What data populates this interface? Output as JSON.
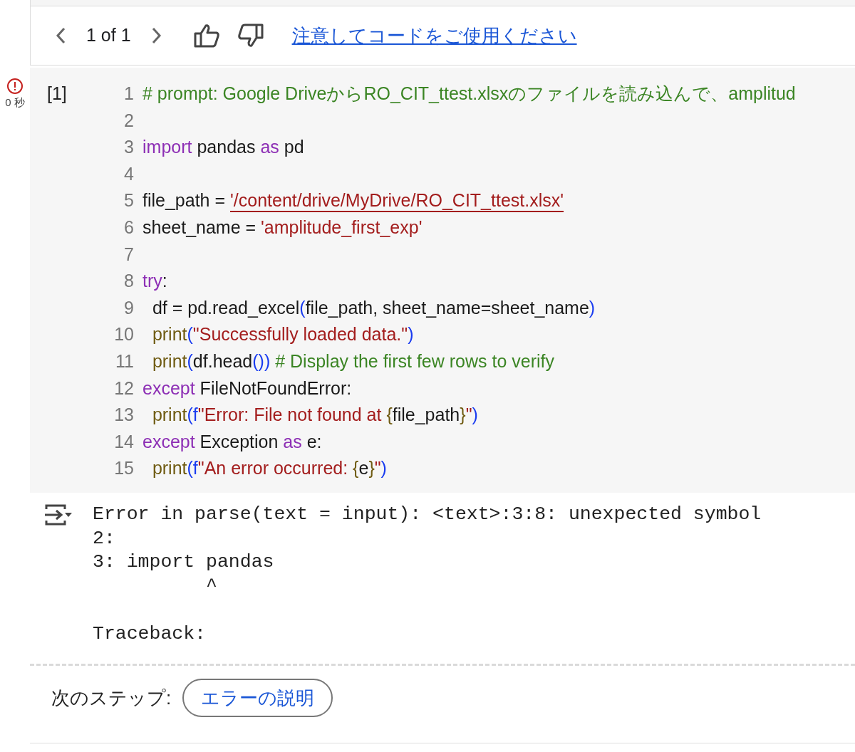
{
  "toolbar": {
    "counter": "1 of 1",
    "link": "注意してコードをご使用ください"
  },
  "cell": {
    "error": true,
    "time": "0 秒",
    "execution_count": "[1]",
    "lines": [
      {
        "number": "1",
        "tokens": [
          {
            "kind": "comment",
            "text": "# prompt: Google DriveからRO_CIT_ttest.xlsxのファイルを読み込んで、amplitud"
          }
        ]
      },
      {
        "number": "2"
      },
      {
        "number": "3",
        "tokens": [
          {
            "kind": "keyword",
            "text": "import"
          },
          {
            "kind": "plain",
            "text": " pandas "
          },
          {
            "kind": "keyword",
            "text": "as"
          },
          {
            "kind": "plain",
            "text": " pd"
          }
        ]
      },
      {
        "number": "4"
      },
      {
        "number": "5",
        "tokens": [
          {
            "kind": "plain",
            "text": "file_path = "
          },
          {
            "kind": "string",
            "text": "'/content/drive/MyDrive/RO_CIT_ttest.xlsx'",
            "warning": true
          }
        ]
      },
      {
        "number": "6",
        "tokens": [
          {
            "kind": "plain",
            "text": "sheet_name = "
          },
          {
            "kind": "string",
            "text": "'amplitude_first_exp'"
          }
        ]
      },
      {
        "number": "7"
      },
      {
        "number": "8",
        "tokens": [
          {
            "kind": "keyword",
            "text": "try"
          },
          {
            "kind": "plain",
            "text": ":"
          }
        ]
      },
      {
        "number": "9",
        "tokens": [
          {
            "kind": "plain",
            "text": "  df = pd.read_excel"
          },
          {
            "kind": "bracket",
            "text": "("
          },
          {
            "kind": "plain",
            "text": "file_path, sheet_name=sheet_name"
          },
          {
            "kind": "bracket",
            "text": ")"
          }
        ]
      },
      {
        "number": "10",
        "tokens": [
          {
            "kind": "function",
            "text": "  print"
          },
          {
            "kind": "bracket",
            "text": "("
          },
          {
            "kind": "string",
            "text": "\"Successfully loaded data.\""
          },
          {
            "kind": "bracket",
            "text": ")"
          }
        ]
      },
      {
        "number": "11",
        "tokens": [
          {
            "kind": "function",
            "text": "  print"
          },
          {
            "kind": "bracket",
            "text": "("
          },
          {
            "kind": "plain",
            "text": "df.head"
          },
          {
            "kind": "bracket",
            "text": "())"
          },
          {
            "kind": "comment",
            "text": " # Display the first few rows to verify"
          }
        ]
      },
      {
        "number": "12",
        "tokens": [
          {
            "kind": "keyword",
            "text": "except"
          },
          {
            "kind": "plain",
            "text": " FileNotFoundError:"
          }
        ]
      },
      {
        "number": "13",
        "tokens": [
          {
            "kind": "function",
            "text": "  print"
          },
          {
            "kind": "bracket",
            "text": "(f"
          },
          {
            "kind": "string",
            "text": "\"Error: File not found at "
          },
          {
            "kind": "function",
            "text": "{"
          },
          {
            "kind": "plain",
            "text": "file_path"
          },
          {
            "kind": "function",
            "text": "}"
          },
          {
            "kind": "string",
            "text": "\""
          },
          {
            "kind": "bracket",
            "text": ")"
          }
        ]
      },
      {
        "number": "14",
        "tokens": [
          {
            "kind": "keyword",
            "text": "except"
          },
          {
            "kind": "plain",
            "text": " Exception "
          },
          {
            "kind": "keyword",
            "text": "as"
          },
          {
            "kind": "plain",
            "text": " e:"
          }
        ]
      },
      {
        "number": "15",
        "tokens": [
          {
            "kind": "function",
            "text": "  print"
          },
          {
            "kind": "bracket",
            "text": "(f"
          },
          {
            "kind": "string",
            "text": "\"An error occurred: "
          },
          {
            "kind": "function",
            "text": "{"
          },
          {
            "kind": "plain",
            "text": "e"
          },
          {
            "kind": "function",
            "text": "}"
          },
          {
            "kind": "string",
            "text": "\""
          },
          {
            "kind": "bracket",
            "text": ")"
          }
        ]
      }
    ]
  },
  "output": {
    "text": "Error in parse(text = input): <text>:3:8: unexpected symbol\n2:\n3: import pandas\n          ^\n\nTraceback:"
  },
  "next_steps": {
    "label": "次のステップ:",
    "buttons": [
      "エラーの説明"
    ]
  }
}
